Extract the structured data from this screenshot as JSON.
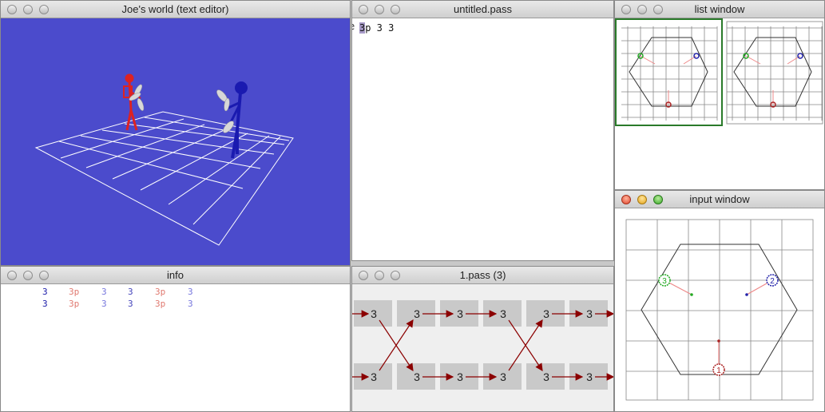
{
  "windows": {
    "world": {
      "title": "Joe's world (text editor)",
      "bg": "#4b4bcc"
    },
    "editor": {
      "title": "untitled.pass",
      "text": "3p 3 3",
      "cursor_char": "3",
      "rest": "p 3 3",
      "left_fragment": "e"
    },
    "list": {
      "title": "list window"
    },
    "input": {
      "title": "input window",
      "labels": [
        "1",
        "2",
        "3"
      ]
    },
    "info": {
      "title": "info",
      "rows": [
        [
          "3",
          "3p",
          "3",
          "3",
          "3p",
          "3"
        ],
        [
          "3",
          "3p",
          "3",
          "3",
          "3p",
          "3"
        ]
      ],
      "colors": [
        "#1a1aa8",
        "#e07a70",
        "#7777dd",
        "#4444bb",
        "#e07a70",
        "#7777dd"
      ]
    },
    "ladder": {
      "title": "1.pass (3)",
      "top_row": [
        "3",
        "3",
        "3",
        "3",
        "3",
        "3"
      ],
      "bottom_row": [
        "3",
        "3",
        "3",
        "3",
        "3",
        "3"
      ]
    }
  }
}
